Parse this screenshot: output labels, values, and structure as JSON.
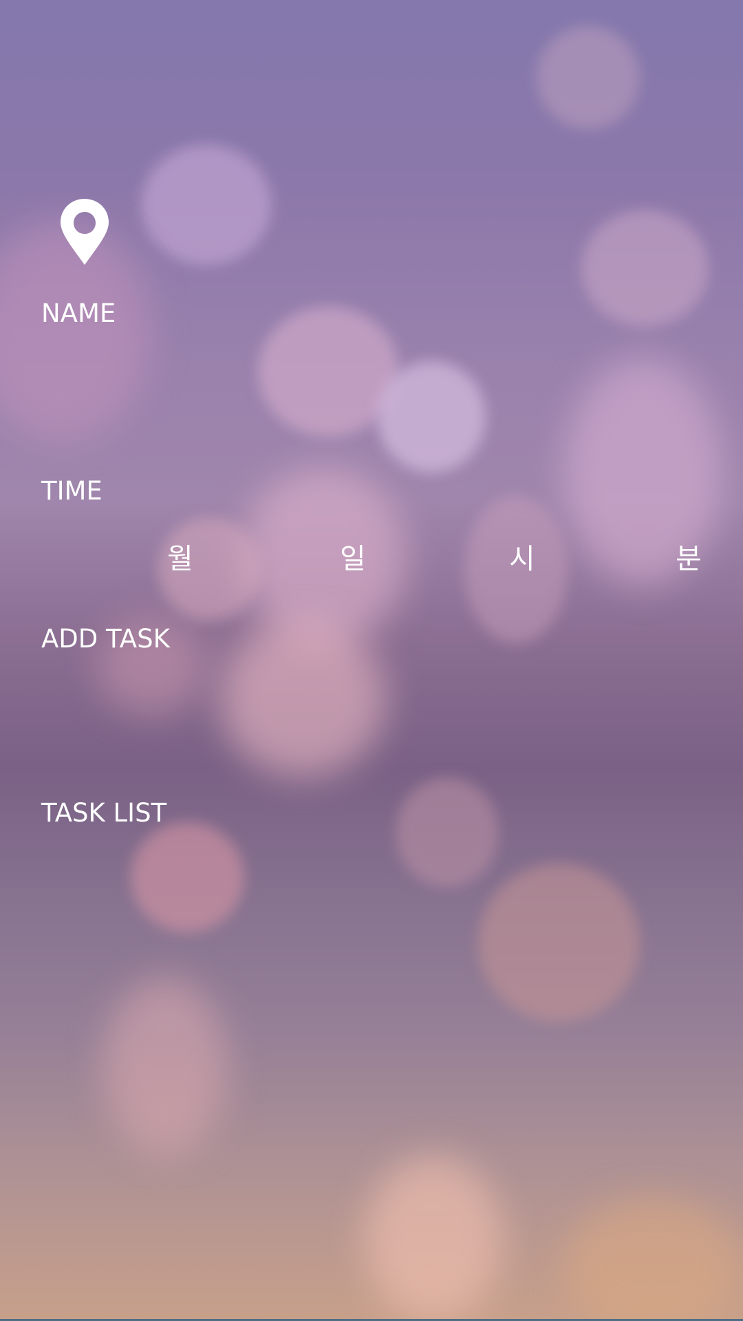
{
  "form": {
    "name_label": "NAME",
    "time_label": "TIME",
    "add_task_label": "ADD TASK",
    "task_list_label": "TASK LIST"
  },
  "time_units": {
    "month": "월",
    "day": "일",
    "hour": "시",
    "minute": "분"
  },
  "icons": {
    "location": "location-pin-icon"
  },
  "colors": {
    "text": "#ffffff",
    "background_top": "#8478ad",
    "background_bottom": "#c8a08a"
  }
}
